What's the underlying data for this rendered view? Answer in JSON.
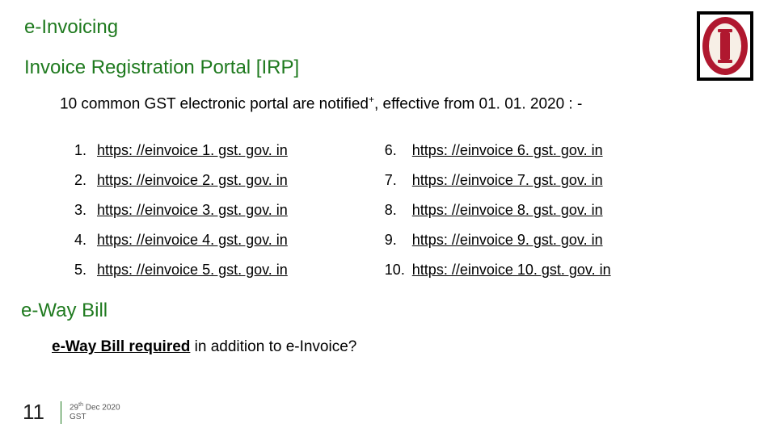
{
  "header": {
    "title1": "e-Invoicing",
    "title2": "Invoice Registration Portal [IRP]"
  },
  "intro": {
    "prefix": "10 common GST electronic portal are notified",
    "sup": "+",
    "suffix": ", effective from 01. 01. 2020 : -"
  },
  "portals": {
    "left": [
      {
        "num": "1.",
        "url": "https: //einvoice 1. gst. gov. in"
      },
      {
        "num": "2.",
        "url": "https: //einvoice 2. gst. gov. in"
      },
      {
        "num": "3.",
        "url": "https: //einvoice 3. gst. gov. in"
      },
      {
        "num": "4.",
        "url": "https: //einvoice 4. gst. gov. in"
      },
      {
        "num": "5.",
        "url": "https: //einvoice 5. gst. gov. in"
      }
    ],
    "right": [
      {
        "num": "6.",
        "url": "https: //einvoice 6. gst. gov. in"
      },
      {
        "num": "7.",
        "url": "https: //einvoice 7. gst. gov. in"
      },
      {
        "num": "8.",
        "url": "https: //einvoice 8. gst. gov. in"
      },
      {
        "num": "9.",
        "url": "https: //einvoice 9. gst. gov. in"
      },
      {
        "num": "10.",
        "url": "https: //einvoice 10. gst. gov. in"
      }
    ]
  },
  "section2": {
    "title": "e-Way Bill",
    "question_bold": "e-Way Bill required",
    "question_rest": " in addition to e-Invoice?"
  },
  "footer": {
    "page": "11",
    "date_day": "29",
    "date_sup": "th",
    "date_rest": " Dec 2020",
    "label": "GST"
  }
}
